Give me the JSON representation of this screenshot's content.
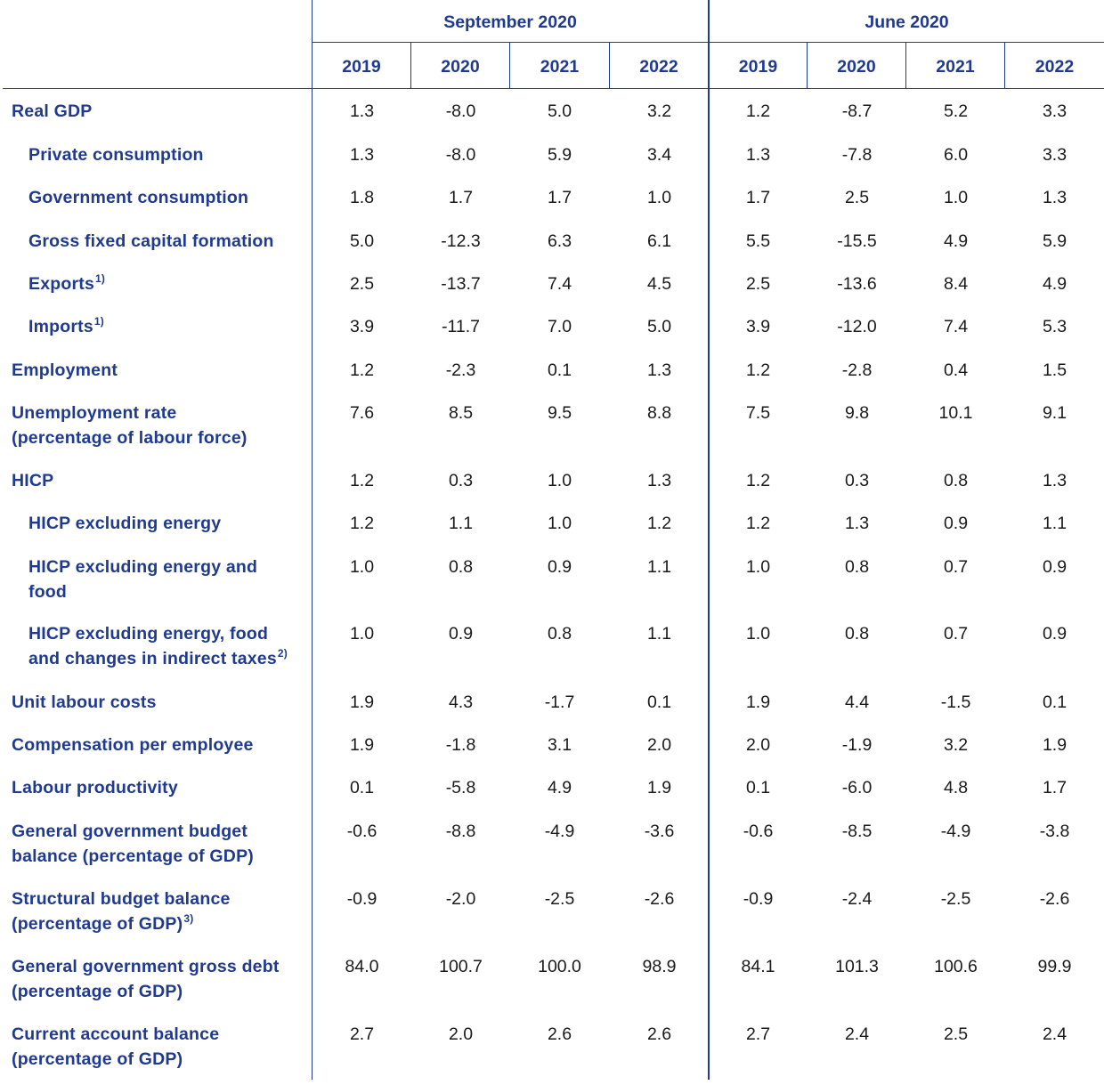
{
  "header": {
    "groups": [
      "September 2020",
      "June 2020"
    ],
    "years": [
      "2019",
      "2020",
      "2021",
      "2022",
      "2019",
      "2020",
      "2021",
      "2022"
    ]
  },
  "rows": [
    {
      "label": [
        "Real GDP"
      ],
      "indent": false,
      "values": [
        "1.3",
        "-8.0",
        "5.0",
        "3.2",
        "1.2",
        "-8.7",
        "5.2",
        "3.3"
      ]
    },
    {
      "label": [
        "Private consumption"
      ],
      "indent": true,
      "values": [
        "1.3",
        "-8.0",
        "5.9",
        "3.4",
        "1.3",
        "-7.8",
        "6.0",
        "3.3"
      ]
    },
    {
      "label": [
        "Government consumption"
      ],
      "indent": true,
      "values": [
        "1.8",
        "1.7",
        "1.7",
        "1.0",
        "1.7",
        "2.5",
        "1.0",
        "1.3"
      ]
    },
    {
      "label": [
        "Gross fixed capital formation"
      ],
      "indent": true,
      "values": [
        "5.0",
        "-12.3",
        "6.3",
        "6.1",
        "5.5",
        "-15.5",
        "4.9",
        "5.9"
      ]
    },
    {
      "label": [
        "Exports"
      ],
      "note": "1)",
      "indent": true,
      "values": [
        "2.5",
        "-13.7",
        "7.4",
        "4.5",
        "2.5",
        "-13.6",
        "8.4",
        "4.9"
      ]
    },
    {
      "label": [
        "Imports"
      ],
      "note": "1)",
      "indent": true,
      "values": [
        "3.9",
        "-11.7",
        "7.0",
        "5.0",
        "3.9",
        "-12.0",
        "7.4",
        "5.3"
      ]
    },
    {
      "label": [
        "Employment"
      ],
      "indent": false,
      "values": [
        "1.2",
        "-2.3",
        "0.1",
        "1.3",
        "1.2",
        "-2.8",
        "0.4",
        "1.5"
      ]
    },
    {
      "label": [
        "Unemployment rate",
        "(percentage of labour force)"
      ],
      "indent": false,
      "values": [
        "7.6",
        "8.5",
        "9.5",
        "8.8",
        "7.5",
        "9.8",
        "10.1",
        "9.1"
      ]
    },
    {
      "label": [
        "HICP"
      ],
      "indent": false,
      "values": [
        "1.2",
        "0.3",
        "1.0",
        "1.3",
        "1.2",
        "0.3",
        "0.8",
        "1.3"
      ]
    },
    {
      "label": [
        "HICP excluding energy"
      ],
      "indent": true,
      "values": [
        "1.2",
        "1.1",
        "1.0",
        "1.2",
        "1.2",
        "1.3",
        "0.9",
        "1.1"
      ]
    },
    {
      "label": [
        "HICP excluding energy and",
        "food"
      ],
      "indent": true,
      "values": [
        "1.0",
        "0.8",
        "0.9",
        "1.1",
        "1.0",
        "0.8",
        "0.7",
        "0.9"
      ]
    },
    {
      "label": [
        "HICP excluding energy, food",
        "and changes in indirect taxes"
      ],
      "note": "2)",
      "indent": true,
      "values": [
        "1.0",
        "0.9",
        "0.8",
        "1.1",
        "1.0",
        "0.8",
        "0.7",
        "0.9"
      ]
    },
    {
      "label": [
        "Unit labour costs"
      ],
      "indent": false,
      "values": [
        "1.9",
        "4.3",
        "-1.7",
        "0.1",
        "1.9",
        "4.4",
        "-1.5",
        "0.1"
      ]
    },
    {
      "label": [
        "Compensation per employee"
      ],
      "indent": false,
      "values": [
        "1.9",
        "-1.8",
        "3.1",
        "2.0",
        "2.0",
        "-1.9",
        "3.2",
        "1.9"
      ]
    },
    {
      "label": [
        "Labour productivity"
      ],
      "indent": false,
      "values": [
        "0.1",
        "-5.8",
        "4.9",
        "1.9",
        "0.1",
        "-6.0",
        "4.8",
        "1.7"
      ]
    },
    {
      "label": [
        "General government budget",
        "balance (percentage of GDP)"
      ],
      "indent": false,
      "values": [
        "-0.6",
        "-8.8",
        "-4.9",
        "-3.6",
        "-0.6",
        "-8.5",
        "-4.9",
        "-3.8"
      ]
    },
    {
      "label": [
        "Structural budget balance",
        "(percentage of GDP)"
      ],
      "note": "3)",
      "indent": false,
      "values": [
        "-0.9",
        "-2.0",
        "-2.5",
        "-2.6",
        "-0.9",
        "-2.4",
        "-2.5",
        "-2.6"
      ]
    },
    {
      "label": [
        "General government gross debt",
        "(percentage of GDP)"
      ],
      "indent": false,
      "values": [
        "84.0",
        "100.7",
        "100.0",
        "98.9",
        "84.1",
        "101.3",
        "100.6",
        "99.9"
      ]
    },
    {
      "label": [
        "Current account balance",
        "(percentage of GDP)"
      ],
      "indent": false,
      "values": [
        "2.7",
        "2.0",
        "2.6",
        "2.6",
        "2.7",
        "2.4",
        "2.5",
        "2.4"
      ]
    }
  ]
}
